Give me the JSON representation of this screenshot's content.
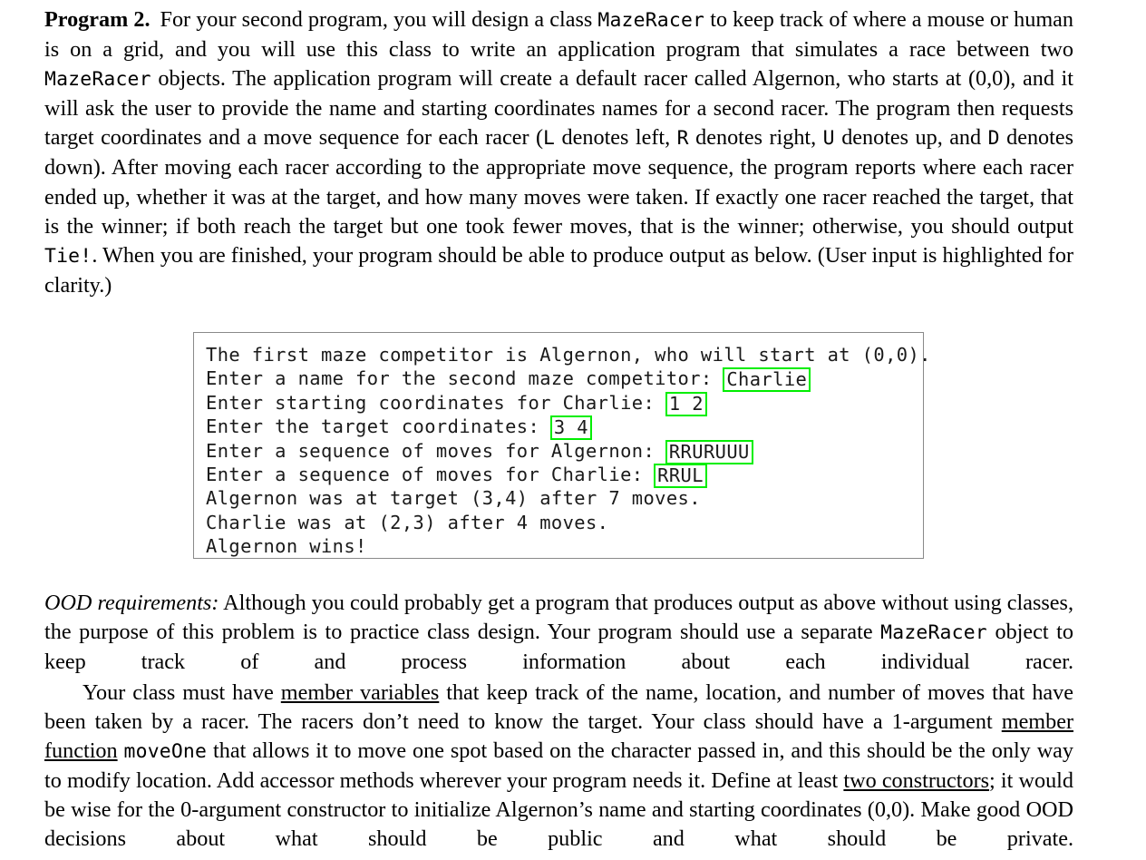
{
  "document": {
    "title": "Program 2",
    "heading_label": "Program 2.",
    "intro": {
      "t1": "For your second program, you will design a class ",
      "c1": "MazeRacer",
      "t2": " to keep track of where a mouse or human is on a grid, and you will use this class to write an application program that simulates a race between two ",
      "c2": "MazeRacer",
      "t3": " objects. The application program will create a default racer called Algernon, who starts at (0,0), and it will ask the user to provide the name and starting coordinates names for a second racer. The program then requests target coordinates and a move sequence for each racer (",
      "c3": "L",
      "t4": " denotes left, ",
      "c4": "R",
      "t5": " denotes right, ",
      "c5": "U",
      "t6": " denotes up, and ",
      "c6": "D",
      "t7": " denotes down). After moving each racer according to the appropriate move sequence, the program reports where each racer ended up, whether it was at the target, and how many moves were taken. If exactly one racer reached the target, that is the winner; if both reach the target but one took fewer moves, that is the winner; otherwise, you should output ",
      "c7": "Tie!",
      "t8": ". When you are finished, your program should be able to produce output as below. (User input is highlighted for clarity.)"
    },
    "ood": {
      "lead": "OOD requirements:",
      "t1": " Although you could probably get a program that produces output as above without using classes, the purpose of this problem is to practice class design. Your program should use a separate ",
      "c1": "MazeRacer",
      "t2": " object to keep track of and process information about each individual racer."
    },
    "classreq": {
      "t1": "Your class must have ",
      "u1": "member variables",
      "t2": " that keep track of the name, location, and number of moves that have been taken by a racer. The racers don’t need to know the target. Your class should have a 1-argument ",
      "u2": "member function",
      "t3": " ",
      "c1": "moveOne",
      "t4": " that allows it to move one spot based on the character passed in, and this should be the only way to modify location. Add accessor methods wherever your program needs it. Define at least ",
      "u3": "two constructors",
      "t5": "; it would be wise for the 0-argument constructor to initialize Algernon’s name and starting coordinates (0,0). Make good OOD decisions about what should be public and what should be private."
    }
  },
  "console": {
    "border_color": "#8a8a8a",
    "highlight_color": "#00ee00",
    "lines": [
      {
        "segments": [
          {
            "text": "The first maze competitor is Algernon, who will start at (0,0).",
            "highlight": false
          }
        ]
      },
      {
        "segments": [
          {
            "text": "Enter a name for the second maze competitor: ",
            "highlight": false
          },
          {
            "text": "Charlie",
            "highlight": true
          }
        ]
      },
      {
        "segments": [
          {
            "text": "Enter starting coordinates for Charlie: ",
            "highlight": false
          },
          {
            "text": "1 2",
            "highlight": true
          }
        ]
      },
      {
        "segments": [
          {
            "text": "Enter the target coordinates: ",
            "highlight": false
          },
          {
            "text": "3 4",
            "highlight": true
          }
        ]
      },
      {
        "segments": [
          {
            "text": "Enter a sequence of moves for Algernon: ",
            "highlight": false
          },
          {
            "text": "RRURUUU",
            "highlight": true
          }
        ]
      },
      {
        "segments": [
          {
            "text": "Enter a sequence of moves for Charlie: ",
            "highlight": false
          },
          {
            "text": "RRUL",
            "highlight": true
          }
        ]
      },
      {
        "segments": [
          {
            "text": "Algernon was at target (3,4) after 7 moves.",
            "highlight": false
          }
        ]
      },
      {
        "segments": [
          {
            "text": "Charlie was at (2,3) after 4 moves.",
            "highlight": false
          }
        ]
      },
      {
        "segments": [
          {
            "text": "Algernon wins!",
            "highlight": false
          }
        ]
      }
    ]
  }
}
